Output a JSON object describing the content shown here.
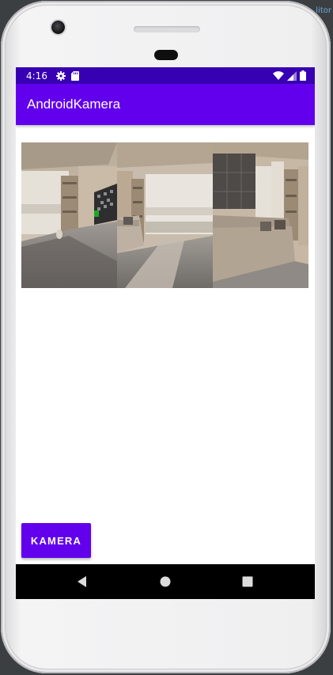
{
  "ide": {
    "hint_text": "litor"
  },
  "status_bar": {
    "time": "4:16",
    "left_icons": [
      "gear-icon",
      "sd-card-icon"
    ],
    "right_icons": [
      "wifi-icon",
      "signal-icon",
      "battery-icon"
    ]
  },
  "app_bar": {
    "title": "AndroidKamera"
  },
  "gallery": {
    "images": [
      {
        "scene": "living-room-tv-shelf"
      },
      {
        "scene": "living-room-window-sofa"
      },
      {
        "scene": "living-room-sofa-panels"
      }
    ]
  },
  "actions": {
    "kamera_label": "KAMERA"
  },
  "nav_bar": {
    "buttons": [
      "back-icon",
      "home-icon",
      "recents-icon"
    ]
  },
  "colors": {
    "status_bar": "#3700b3",
    "primary": "#6200ee",
    "nav_bar": "#000000"
  }
}
